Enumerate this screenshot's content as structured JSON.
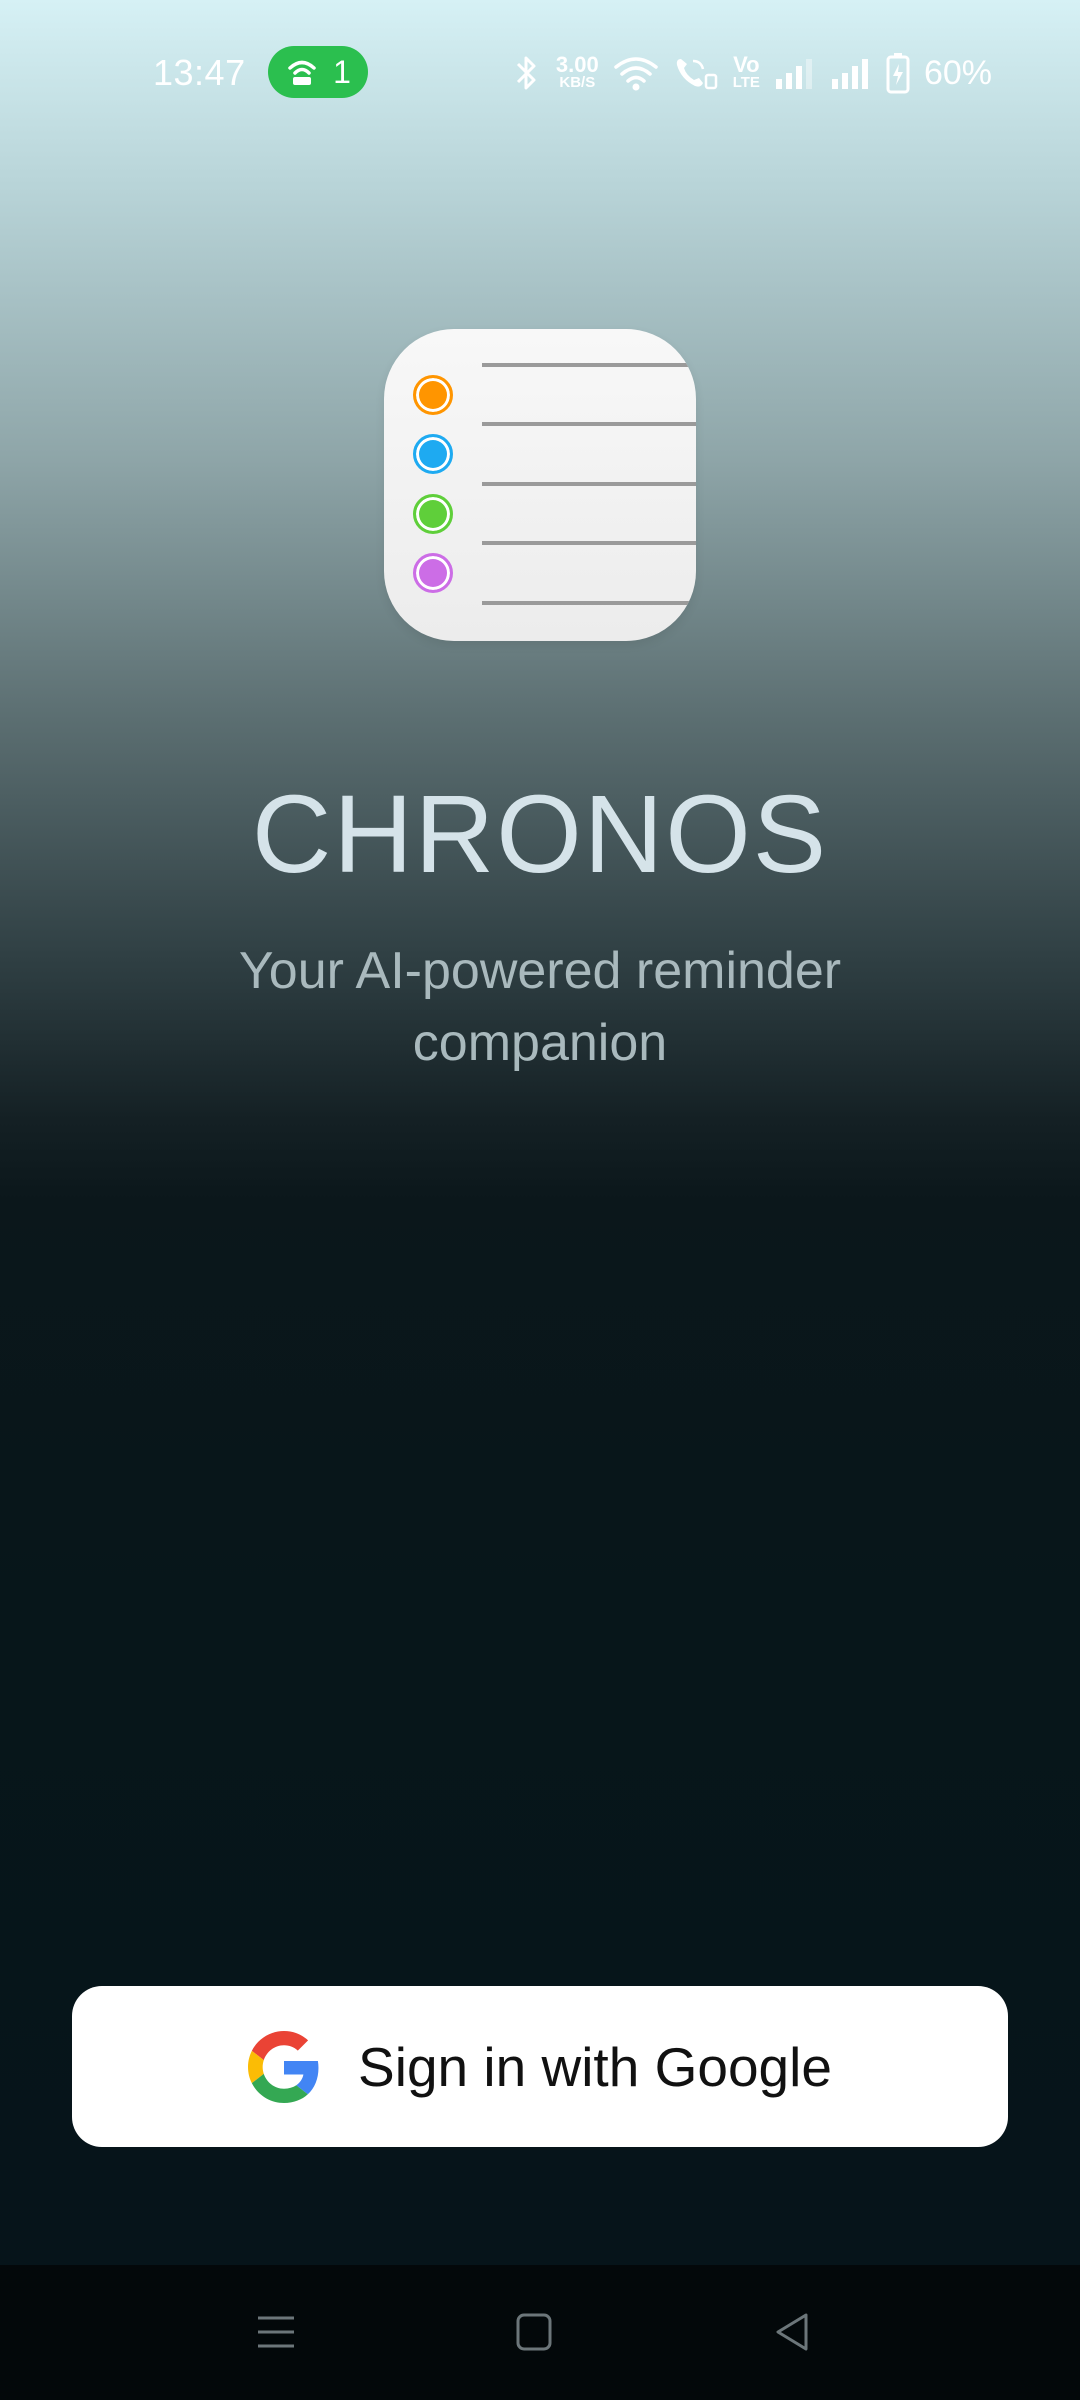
{
  "status_bar": {
    "time": "13:47",
    "hotspot_count": "1",
    "net_speed_value": "3.00",
    "net_speed_unit": "KB/S",
    "volte_top": "Vo",
    "volte_bottom": "LTE",
    "battery_percent": "60%"
  },
  "app": {
    "title": "CHRONOS",
    "subtitle": "Your AI-powered reminder companion",
    "icon_dot_colors": [
      "#ff9500",
      "#1eaaf1",
      "#5fcf3a",
      "#cc6de6"
    ]
  },
  "signin": {
    "label": "Sign in with Google"
  },
  "nav": {
    "items": [
      "menu-icon",
      "home-icon",
      "back-icon"
    ]
  },
  "colors": {
    "accent_green": "#2bbf4f",
    "title_color": "#d5e3e9",
    "background_dark": "#07161a"
  }
}
